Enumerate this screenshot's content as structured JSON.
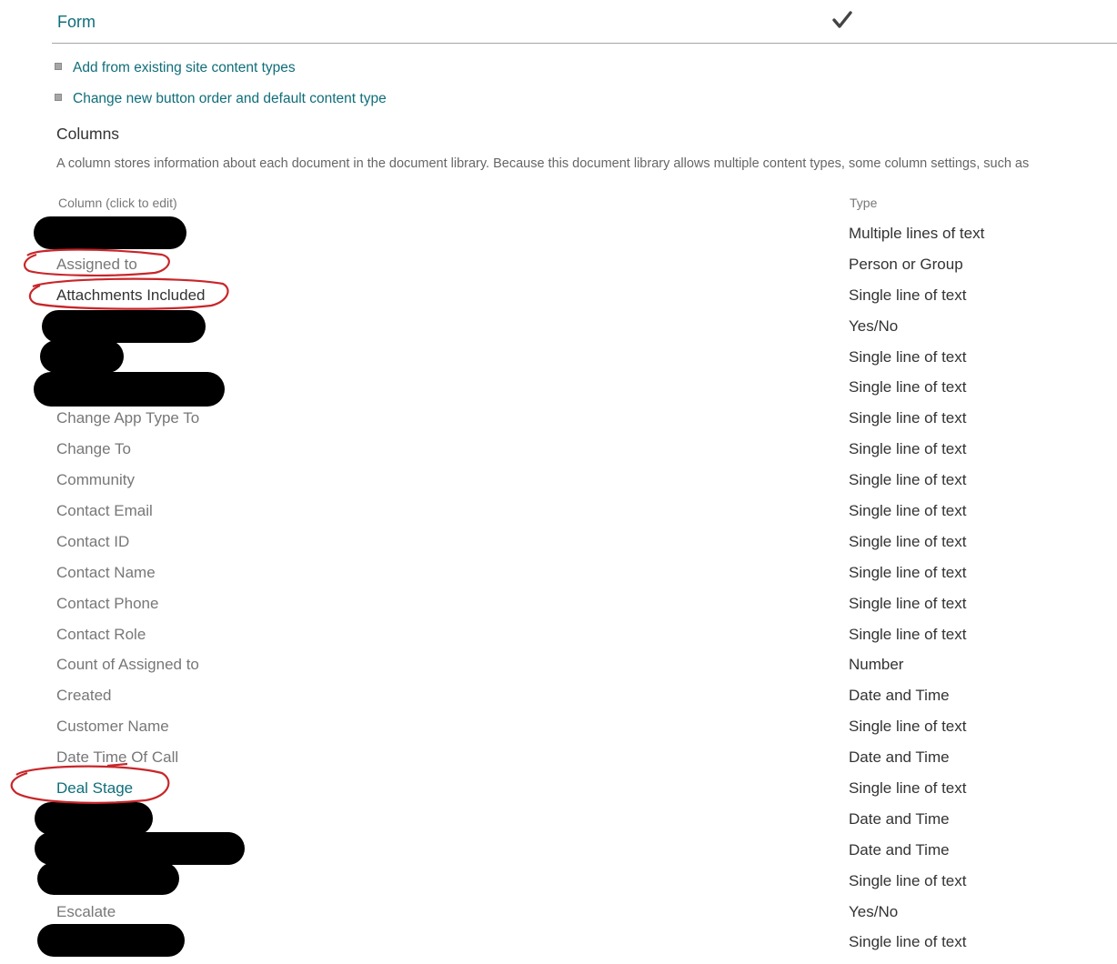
{
  "form_row": {
    "label": "Form",
    "check_icon": "checkmark-icon"
  },
  "links": [
    {
      "label": "Add from existing site content types"
    },
    {
      "label": "Change new button order and default content type"
    }
  ],
  "columns_section": {
    "heading": "Columns",
    "description": "A column stores information about each document in the document library. Because this document library allows multiple content types, some column settings, such as",
    "header_column": "Column (click to edit)",
    "header_type": "Type"
  },
  "columns": [
    {
      "name": "",
      "type": "Multiple lines of text",
      "redacted": true
    },
    {
      "name": "Assigned to",
      "type": "Person or Group"
    },
    {
      "name": "Attachments Included",
      "type": "Single line of text"
    },
    {
      "name": "",
      "type": "Yes/No",
      "redacted": true
    },
    {
      "name": "",
      "type": "Single line of text",
      "redacted": true
    },
    {
      "name": "",
      "type": "Single line of text",
      "redacted": true
    },
    {
      "name": "Change App Type To",
      "type": "Single line of text"
    },
    {
      "name": "Change To",
      "type": "Single line of text"
    },
    {
      "name": "Community",
      "type": "Single line of text"
    },
    {
      "name": "Contact Email",
      "type": "Single line of text"
    },
    {
      "name": "Contact ID",
      "type": "Single line of text"
    },
    {
      "name": "Contact Name",
      "type": "Single line of text"
    },
    {
      "name": "Contact Phone",
      "type": "Single line of text"
    },
    {
      "name": "Contact Role",
      "type": "Single line of text"
    },
    {
      "name": "Count of Assigned to",
      "type": "Number"
    },
    {
      "name": "Created",
      "type": "Date and Time"
    },
    {
      "name": "Customer Name",
      "type": "Single line of text"
    },
    {
      "name": "Date Time Of Call",
      "type": "Date and Time"
    },
    {
      "name": "Deal Stage",
      "type": "Single line of text"
    },
    {
      "name": "",
      "type": "Date and Time",
      "redacted": true
    },
    {
      "name": "",
      "type": "Date and Time",
      "redacted": true
    },
    {
      "name": "",
      "type": "Single line of text",
      "redacted": true
    },
    {
      "name": "Escalate",
      "type": "Yes/No"
    },
    {
      "name": "",
      "type": "Single line of text",
      "redacted": true
    }
  ],
  "colors": {
    "link": "#0f6e7a",
    "annotation": "#c8262a",
    "redaction": "#000000"
  }
}
